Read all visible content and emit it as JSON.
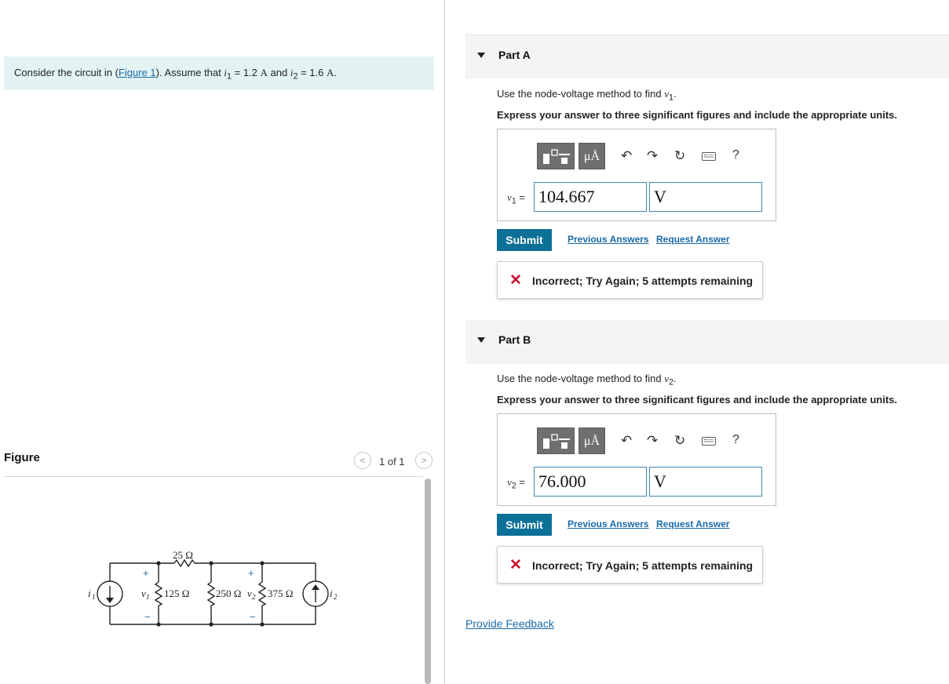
{
  "problem": {
    "text_before": "Consider the circuit in (",
    "link": "Figure 1",
    "text_after": "). Assume that ",
    "i1_sym": "i",
    "i1_sub": "1",
    "i1_val": " = 1.2 ",
    "unit_A1": "A",
    "and": " and ",
    "i2_sym": "i",
    "i2_sub": "2",
    "i2_val": " = 1.6 ",
    "unit_A2": "A",
    "end": "."
  },
  "figure": {
    "title": "Figure",
    "pager": "1 of 1",
    "prev_glyph": "<",
    "next_glyph": ">",
    "circuit": {
      "r1": "25 Ω",
      "r2": "125 Ω",
      "r3": "250 Ω",
      "r4": "375 Ω",
      "i1": "i",
      "i1_sub": "1",
      "i2": "i",
      "i2_sub": "2",
      "v1": "v",
      "v1_sub": "1",
      "v2": "v",
      "v2_sub": "2",
      "plus": "+",
      "minus": "−"
    }
  },
  "partA": {
    "title": "Part A",
    "instruction_pre": "Use the node-voltage method to find ",
    "var": "v",
    "var_sub": "1",
    "instruction_post": ".",
    "emphasis": "Express your answer to three significant figures and include the appropriate units.",
    "label_var": "v",
    "label_sub": "1",
    "label_eq": " =",
    "value": "104.667",
    "unit": "V",
    "mu_label": "μÅ",
    "help": "?",
    "submit": "Submit",
    "previous": "Previous Answers",
    "request": "Request Answer",
    "feedback": "Incorrect; Try Again; 5 attempts remaining"
  },
  "partB": {
    "title": "Part B",
    "instruction_pre": "Use the node-voltage method to find ",
    "var": "v",
    "var_sub": "2",
    "instruction_post": ".",
    "emphasis": "Express your answer to three significant figures and include the appropriate units.",
    "label_var": "v",
    "label_sub": "2",
    "label_eq": " =",
    "value": "76.000",
    "unit": "V",
    "mu_label": "μÅ",
    "help": "?",
    "submit": "Submit",
    "previous": "Previous Answers",
    "request": "Request Answer",
    "feedback": "Incorrect; Try Again; 5 attempts remaining"
  },
  "footer": {
    "provide_feedback": "Provide Feedback"
  },
  "colors": {
    "accent": "#0d7097",
    "link": "#1a6aa8",
    "error": "#c8102e",
    "problem_bg": "#e3f3f3"
  }
}
